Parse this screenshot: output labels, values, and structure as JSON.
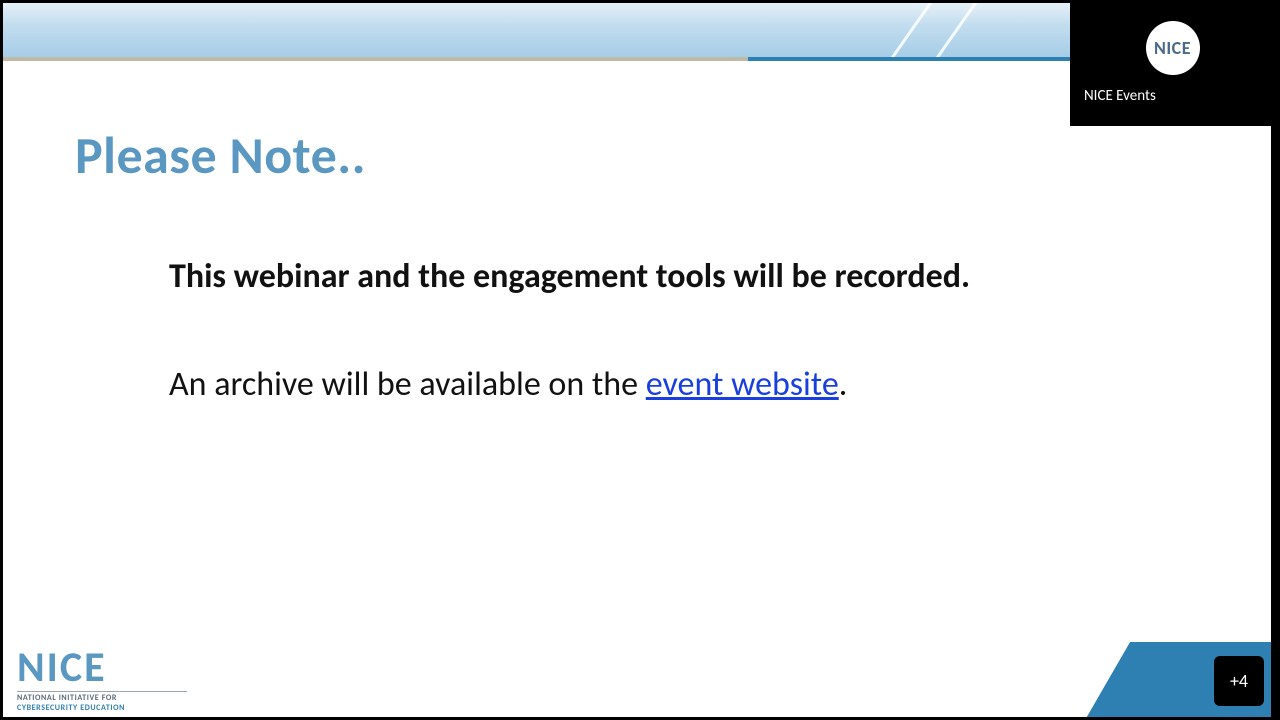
{
  "slide": {
    "title": "Please Note..",
    "body_line1": "This webinar and the engagement tools will be recorded.",
    "body_line2_pre": "An archive will be available on the ",
    "body_link": "event website",
    "body_line2_post": "."
  },
  "footer_logo": {
    "name": "NICE",
    "sub1": "NATIONAL INITIATIVE FOR",
    "sub2": "CYBERSECURITY EDUCATION"
  },
  "participant": {
    "avatar_text": "NICE",
    "name": "NICE Events"
  },
  "more_badge": "+4"
}
